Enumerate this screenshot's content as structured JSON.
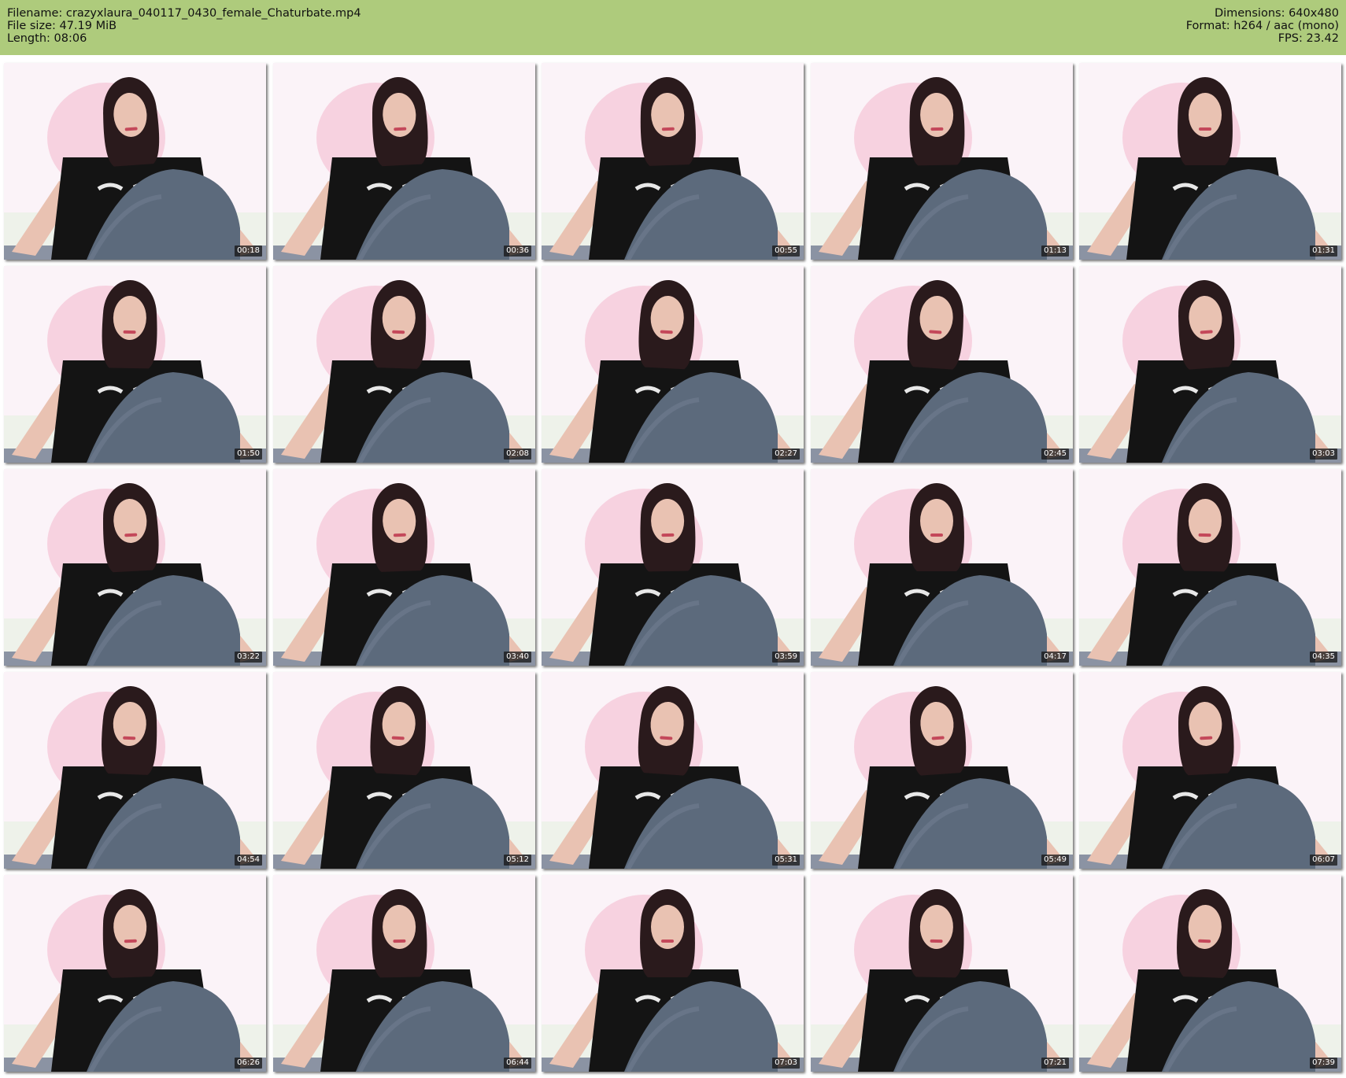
{
  "header": {
    "filename_label": "Filename:",
    "filename": "crazyxlaura_040117_0430_female_Chaturbate.mp4",
    "filesize_label": "File size:",
    "filesize": "47.19 MiB",
    "length_label": "Length:",
    "length": "08:06",
    "dimensions_label": "Dimensions:",
    "dimensions": "640x480",
    "format_label": "Format:",
    "format": "h264 / aac (mono)",
    "fps_label": "FPS:",
    "fps": "23.42"
  },
  "colors": {
    "header_bg": "#aecb7c",
    "wall": "#fbf3f8",
    "pink_backdrop": "#f6c9da",
    "hair": "#2a1a1c",
    "shirt": "#141414",
    "jeans": "#5c6a7c",
    "skin": "#e9c2b2"
  },
  "grid": {
    "columns": 5,
    "rows": 5
  },
  "thumbnails": [
    {
      "timestamp": "00:18"
    },
    {
      "timestamp": "00:36"
    },
    {
      "timestamp": "00:55"
    },
    {
      "timestamp": "01:13"
    },
    {
      "timestamp": "01:31"
    },
    {
      "timestamp": "01:50"
    },
    {
      "timestamp": "02:08"
    },
    {
      "timestamp": "02:27"
    },
    {
      "timestamp": "02:45"
    },
    {
      "timestamp": "03:03"
    },
    {
      "timestamp": "03:22"
    },
    {
      "timestamp": "03:40"
    },
    {
      "timestamp": "03:59"
    },
    {
      "timestamp": "04:17"
    },
    {
      "timestamp": "04:35"
    },
    {
      "timestamp": "04:54"
    },
    {
      "timestamp": "05:12"
    },
    {
      "timestamp": "05:31"
    },
    {
      "timestamp": "05:49"
    },
    {
      "timestamp": "06:07"
    },
    {
      "timestamp": "06:26"
    },
    {
      "timestamp": "06:44"
    },
    {
      "timestamp": "07:03"
    },
    {
      "timestamp": "07:21"
    },
    {
      "timestamp": "07:39"
    }
  ]
}
